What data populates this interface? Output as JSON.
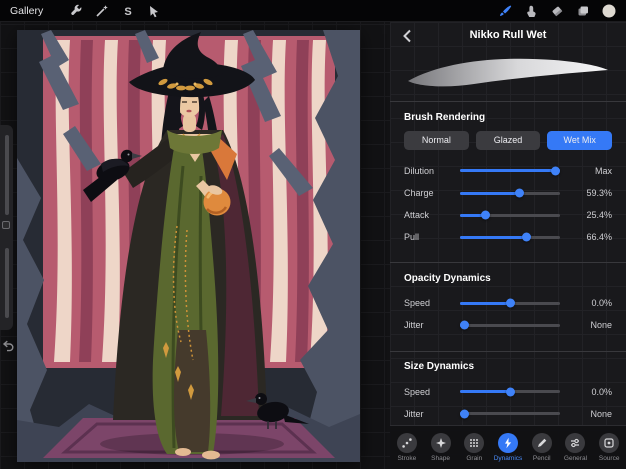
{
  "colors": {
    "accent": "#3579f6",
    "panel_bg": "#19191c",
    "topbar_bg": "#050506"
  },
  "topbar": {
    "gallery_label": "Gallery",
    "left_tools": [
      "wrench-icon",
      "adjustments-wand-icon",
      "selection-icon",
      "transform-arrow-icon"
    ],
    "selection_glyph": "S",
    "right_tools": [
      "paint-brush-icon",
      "smudge-icon",
      "eraser-icon",
      "layers-icon",
      "color-swatch"
    ]
  },
  "sidebar": {
    "tools": [
      "brush-size-slider",
      "modify-button",
      "opacity-slider",
      "undo-button"
    ]
  },
  "canvas": {
    "artwork": "painting of a witch in a wide-brim hat with golden laurel, green gown, orange orb and two ravens on a pink striped backdrop"
  },
  "panel": {
    "title": "Nikko Rull Wet",
    "sections": {
      "brush_rendering": {
        "title": "Brush Rendering",
        "modes": [
          {
            "label": "Normal",
            "selected": false
          },
          {
            "label": "Glazed",
            "selected": false
          },
          {
            "label": "Wet Mix",
            "selected": true
          }
        ],
        "sliders": [
          {
            "label": "Dilution",
            "value": "Max",
            "fraction": 1
          },
          {
            "label": "Charge",
            "value": "59.3%",
            "fraction": 0.593
          },
          {
            "label": "Attack",
            "value": "25.4%",
            "fraction": 0.254
          },
          {
            "label": "Pull",
            "value": "66.4%",
            "fraction": 0.664
          }
        ]
      },
      "opacity_dynamics": {
        "title": "Opacity Dynamics",
        "sliders": [
          {
            "label": "Speed",
            "value": "0.0%",
            "fraction": 0.5
          },
          {
            "label": "Jitter",
            "value": "None",
            "fraction": 0.02
          }
        ]
      },
      "size_dynamics": {
        "title": "Size Dynamics",
        "sliders": [
          {
            "label": "Speed",
            "value": "0.0%",
            "fraction": 0.5
          },
          {
            "label": "Jitter",
            "value": "None",
            "fraction": 0.02
          }
        ]
      }
    },
    "tabs": [
      {
        "label": "Stroke",
        "selected": false
      },
      {
        "label": "Shape",
        "selected": false
      },
      {
        "label": "Grain",
        "selected": false
      },
      {
        "label": "Dynamics",
        "selected": true
      },
      {
        "label": "Pencil",
        "selected": false
      },
      {
        "label": "General",
        "selected": false
      },
      {
        "label": "Source",
        "selected": false
      }
    ]
  }
}
